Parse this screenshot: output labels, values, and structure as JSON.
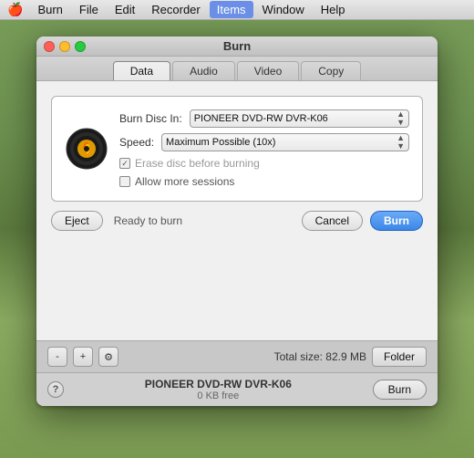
{
  "menubar": {
    "apple": "🍎",
    "items": [
      {
        "label": "Burn",
        "active": false
      },
      {
        "label": "File",
        "active": false
      },
      {
        "label": "Edit",
        "active": false
      },
      {
        "label": "Recorder",
        "active": false
      },
      {
        "label": "Items",
        "active": true
      },
      {
        "label": "Window",
        "active": false
      },
      {
        "label": "Help",
        "active": false
      }
    ]
  },
  "window": {
    "title": "Burn",
    "tabs": [
      {
        "label": "Data",
        "active": true
      },
      {
        "label": "Audio",
        "active": false
      },
      {
        "label": "Video",
        "active": false
      },
      {
        "label": "Copy",
        "active": false
      }
    ]
  },
  "burn_settings": {
    "burn_disc_label": "Burn Disc In:",
    "drive_name": "PIONEER DVD-RW DVR-K06",
    "speed_label": "Speed:",
    "speed_value": "Maximum Possible (10x)",
    "erase_label": "Erase disc before burning",
    "sessions_label": "Allow more sessions",
    "erase_checked": true,
    "sessions_checked": false
  },
  "action_bar": {
    "eject_label": "Eject",
    "status_text": "Ready to burn",
    "cancel_label": "Cancel",
    "burn_label": "Burn"
  },
  "toolbar": {
    "minus_label": "-",
    "plus_label": "+",
    "gear_label": "⚙",
    "total_size_label": "Total size: 82.9 MB",
    "folder_label": "Folder"
  },
  "status_bar": {
    "help_label": "?",
    "drive_name": "PIONEER DVD-RW DVR-K06",
    "drive_free": "0 KB free",
    "burn_label": "Burn"
  }
}
